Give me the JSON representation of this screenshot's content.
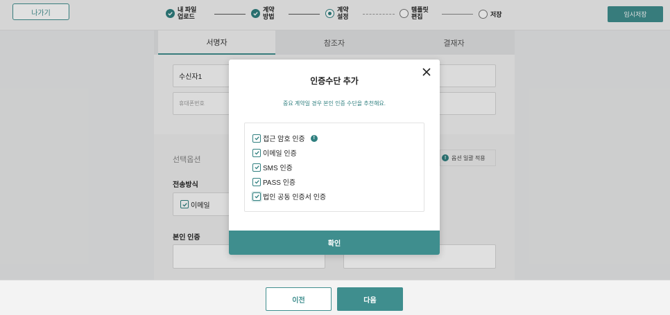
{
  "header": {
    "exit_label": "나가기",
    "temp_save_label": "임시저장",
    "steps": [
      {
        "line1": "내 파일",
        "line2": "업로드",
        "state": "done"
      },
      {
        "line1": "계약",
        "line2": "방법",
        "state": "done"
      },
      {
        "line1": "계약",
        "line2": "설정",
        "state": "current"
      },
      {
        "line1": "템플릿",
        "line2": "편집",
        "state": "todo"
      },
      {
        "line1": "저장",
        "line2": "",
        "state": "todo"
      }
    ]
  },
  "tabs": [
    "서명자",
    "참조자",
    "결재자"
  ],
  "form": {
    "recipient_value": "수신자1",
    "phone_placeholder": "휴대폰번호",
    "options_title": "선택옵션",
    "apply_all_label": "옵션 일괄 적용",
    "send_method_label": "전송방식",
    "email_label": "이메일",
    "identity_label": "본인 인증"
  },
  "modal": {
    "title": "인증수단 추가",
    "subtitle": "중요 계약일 경우 본인 인증 수단을 추천해요.",
    "options": [
      {
        "label": "접근 암호 인증",
        "checked": true,
        "info": true
      },
      {
        "label": "이메일 인증",
        "checked": true,
        "info": false
      },
      {
        "label": "SMS 인증",
        "checked": true,
        "info": false
      },
      {
        "label": "PASS 인증",
        "checked": true,
        "info": false
      },
      {
        "label": "법인 공동 인증서 인증",
        "checked": true,
        "info": false
      }
    ],
    "confirm_label": "확인",
    "info_icon_text": "!"
  },
  "footer": {
    "prev_label": "이전",
    "next_label": "다음"
  },
  "colors": {
    "accent": "#3f8e8e",
    "accent_dark": "#2f7f7f"
  }
}
